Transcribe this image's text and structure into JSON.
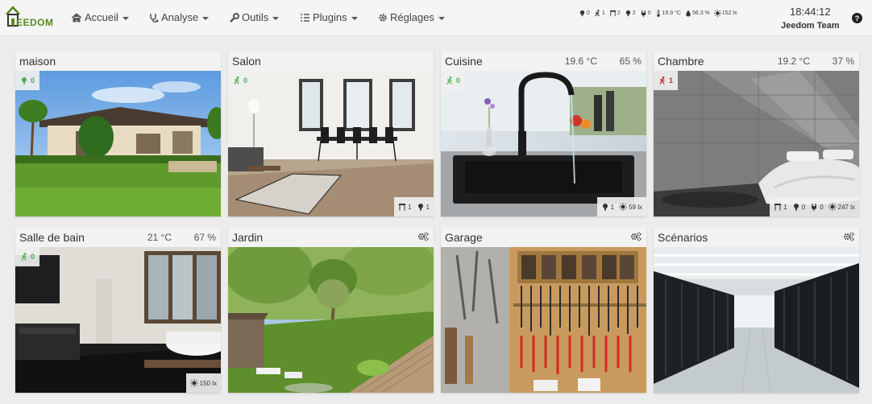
{
  "app": {
    "logo_text": "EEDOM"
  },
  "nav": {
    "home": "Accueil",
    "analysis": "Analyse",
    "tools": "Outils",
    "plugins": "Plugins",
    "settings": "Réglages"
  },
  "summary": [
    {
      "icon": "light-icon",
      "value": "0"
    },
    {
      "icon": "motion-icon",
      "value": "1"
    },
    {
      "icon": "shutter-icon",
      "value": "2"
    },
    {
      "icon": "light-icon",
      "value": "2"
    },
    {
      "icon": "plug-icon",
      "value": "0"
    },
    {
      "icon": "thermometer-icon",
      "value": "19.9 °C"
    },
    {
      "icon": "humidity-icon",
      "value": "56.3 %"
    },
    {
      "icon": "luminosity-icon",
      "value": "152 lx"
    }
  ],
  "clock": "18:44:12",
  "user": "Jeedom Team",
  "colors": {
    "accent_green": "#4caf50",
    "alert_red": "#c62828",
    "logo_green": "#5a8a1e"
  },
  "tiles": [
    {
      "name": "maison",
      "badge": {
        "icon": "light-icon",
        "value": "0",
        "state": "ok"
      }
    },
    {
      "name": "Salon",
      "badge": {
        "icon": "motion-icon",
        "value": "0",
        "state": "ok"
      },
      "bottom": [
        {
          "icon": "shutter-icon",
          "value": "1"
        },
        {
          "icon": "light-icon",
          "value": "1"
        }
      ]
    },
    {
      "name": "Cuisine",
      "temp": "19.6 °C",
      "hum": "65 %",
      "badge": {
        "icon": "motion-icon",
        "value": "0",
        "state": "ok"
      },
      "bottom": [
        {
          "icon": "light-icon",
          "value": "1"
        },
        {
          "icon": "luminosity-icon",
          "value": "59 lx"
        }
      ]
    },
    {
      "name": "Chambre",
      "temp": "19.2 °C",
      "hum": "37 %",
      "badge": {
        "icon": "motion-icon",
        "value": "1",
        "state": "alert"
      },
      "bottom": [
        {
          "icon": "shutter-icon",
          "value": "1"
        },
        {
          "icon": "light-icon",
          "value": "0"
        },
        {
          "icon": "plug-icon",
          "value": "0"
        },
        {
          "icon": "luminosity-icon",
          "value": "247 lx"
        }
      ]
    },
    {
      "name": "Salle de bain",
      "temp": "21 °C",
      "hum": "67 %",
      "badge": {
        "icon": "motion-icon",
        "value": "0",
        "state": "ok"
      },
      "bottom": [
        {
          "icon": "luminosity-icon",
          "value": "150 lx"
        }
      ]
    },
    {
      "name": "Jardin"
    },
    {
      "name": "Garage"
    },
    {
      "name": "Scénarios"
    }
  ]
}
